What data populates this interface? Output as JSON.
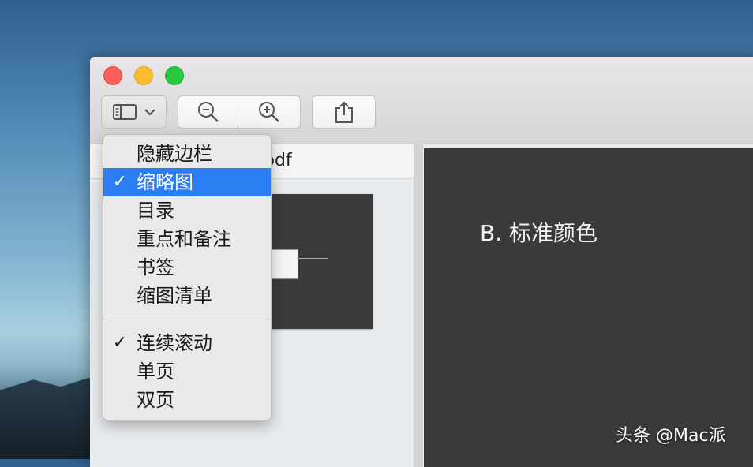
{
  "toolbar": {
    "sidebar_button": "sidebar-toggle",
    "zoom_out": "zoom-out",
    "zoom_in": "zoom-in",
    "share": "share"
  },
  "sidebar": {
    "document_name": "pdf"
  },
  "page": {
    "heading": "B. 标准颜色"
  },
  "menu": {
    "items": [
      {
        "label": "隐藏边栏",
        "checked": false
      },
      {
        "label": "缩略图",
        "checked": true,
        "selected": true
      },
      {
        "label": "目录",
        "checked": false
      },
      {
        "label": "重点和备注",
        "checked": false
      },
      {
        "label": "书签",
        "checked": false
      },
      {
        "label": "缩图清单",
        "checked": false
      }
    ],
    "items2": [
      {
        "label": "连续滚动",
        "checked": true
      },
      {
        "label": "单页",
        "checked": false
      },
      {
        "label": "双页",
        "checked": false
      }
    ],
    "checkmark": "✓"
  },
  "watermark": "头条 @Mac派",
  "colors": {
    "accent": "#2a7ef2",
    "close": "#fc5f57",
    "minimize": "#fdbc2e",
    "zoom": "#28c840"
  }
}
